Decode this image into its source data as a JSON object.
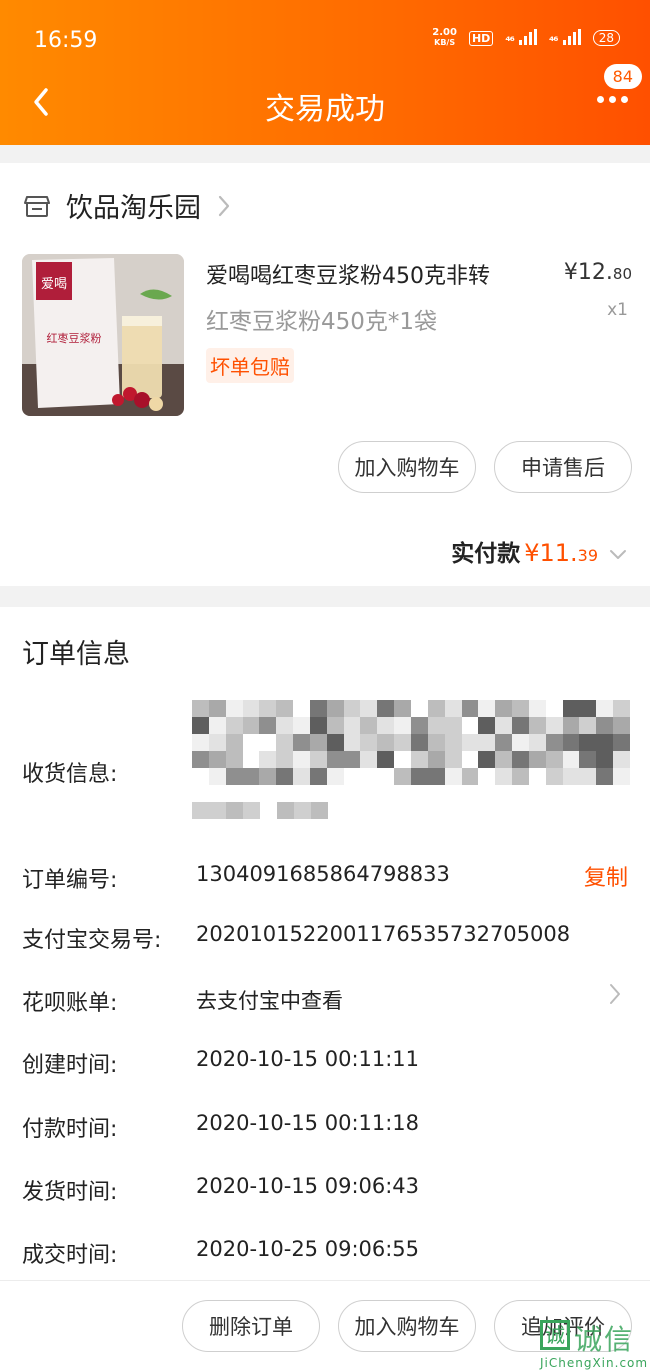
{
  "status_bar": {
    "time": "16:59",
    "net_speed_value": "2.00",
    "net_speed_unit": "KB/S",
    "hd_label": "HD",
    "signal1_label": "⁴⁶",
    "signal2_label": "⁴⁶",
    "battery": "28"
  },
  "nav": {
    "title": "交易成功",
    "badge_count": "84"
  },
  "shop": {
    "name": "饮品淘乐园",
    "icon": "store-icon"
  },
  "product": {
    "title": "爱喝喝红枣豆浆粉450克非转",
    "price_main": "¥12.",
    "price_cents": "80",
    "spec": "红枣豆浆粉450克*1袋",
    "qty": "x1",
    "tag": "坏单包赔",
    "add_cart_label": "加入购物车",
    "after_sale_label": "申请售后"
  },
  "payment": {
    "label": "实付款",
    "amount_main": "¥11.",
    "amount_cents": "39"
  },
  "order_info": {
    "section_title": "订单信息",
    "address_label": "收货信息:",
    "order_no_label": "订单编号:",
    "order_no": "1304091685864798833",
    "copy_label": "复制",
    "alipay_label": "支付宝交易号:",
    "alipay_no": "2020101522001176535732705008",
    "huabei_label": "花呗账单:",
    "huabei_value": "去支付宝中查看",
    "created_label": "创建时间:",
    "created": "2020-10-15 00:11:11",
    "paid_label": "付款时间:",
    "paid": "2020-10-15 00:11:18",
    "shipped_label": "发货时间:",
    "shipped": "2020-10-15 09:06:43",
    "closed_label": "成交时间:",
    "closed": "2020-10-25 09:06:55"
  },
  "bottom_actions": {
    "delete_label": "删除订单",
    "add_cart_label": "加入购物车",
    "review_label": "追加评价"
  },
  "watermark": {
    "box_char": "诚",
    "text": "诚信",
    "sub": "JiChengXin.com"
  },
  "colors": {
    "header_start": "#ff8a00",
    "header_end": "#ff5000",
    "accent": "#ff5000"
  }
}
